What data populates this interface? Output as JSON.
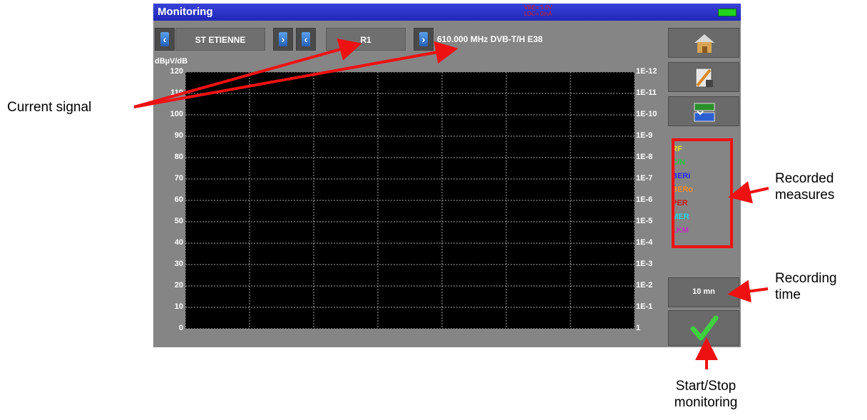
{
  "window": {
    "title": "Monitoring",
    "status_line1": "VBE= 5.0V",
    "status_line2": "LDC= 0mA"
  },
  "toolbar": {
    "site": "ST ETIENNE",
    "channel": "R1",
    "frequency_info": "610.000 MHz  DVB-T/H  E38",
    "prev_icon": "chevron-left-icon",
    "next_icon": "chevron-right-icon"
  },
  "plot": {
    "y_unit": "dBµV/dB",
    "left_ticks": [
      "120",
      "110",
      "100",
      "90",
      "80",
      "70",
      "60",
      "50",
      "40",
      "30",
      "20",
      "10",
      "0"
    ],
    "right_ticks": [
      "1E-12",
      "1E-11",
      "1E-10",
      "1E-9",
      "1E-8",
      "1E-7",
      "1E-6",
      "1E-5",
      "1E-4",
      "1E-3",
      "1E-2",
      "1E-1",
      "1"
    ]
  },
  "legend": [
    {
      "label": "RF",
      "color": "#e8e020"
    },
    {
      "label": "C/N",
      "color": "#25c43a"
    },
    {
      "label": "BERi",
      "color": "#2525ff"
    },
    {
      "label": "BERo",
      "color": "#ff8a20"
    },
    {
      "label": "PER",
      "color": "#d01515"
    },
    {
      "label": "MER",
      "color": "#20d6e8"
    },
    {
      "label": "LKM",
      "color": "#c030c0"
    }
  ],
  "sidebar": {
    "home_icon": "home-icon",
    "tools_icon": "tools-icon",
    "display_icon": "display-switch-icon",
    "recording_time": "10 mn",
    "start_icon": "checkmark-icon"
  },
  "callouts": {
    "current_signal": "Current signal",
    "recorded_measures_1": "Recorded",
    "recorded_measures_2": "measures",
    "recording_time_1": "Recording",
    "recording_time_2": "time",
    "start_stop_1": "Start/Stop",
    "start_stop_2": "monitoring"
  },
  "colors": {
    "highlight": "#ee1111",
    "titlebar": "#2a33c8"
  }
}
